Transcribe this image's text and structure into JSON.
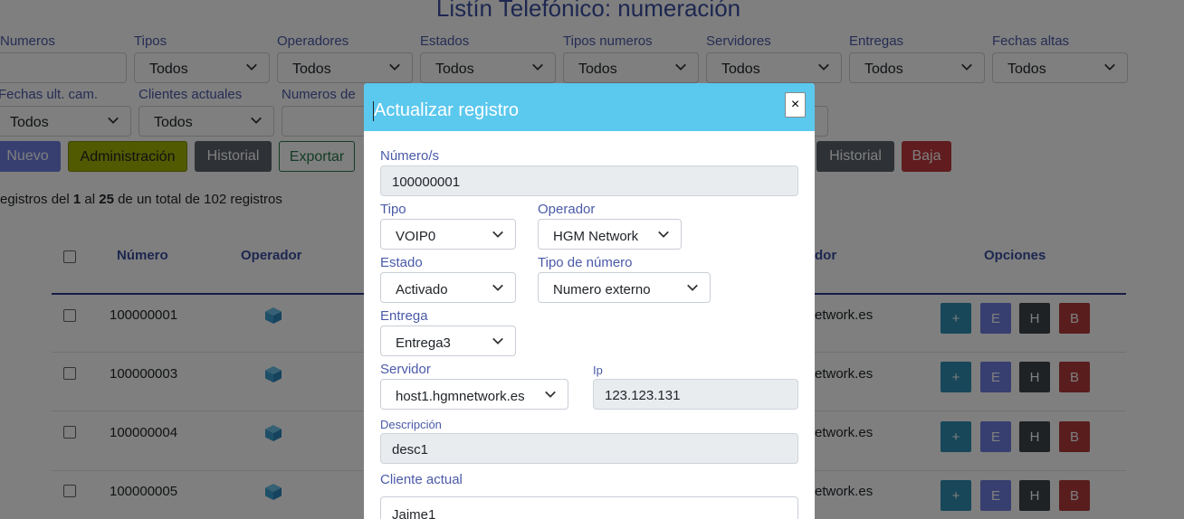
{
  "page_title": "Listín Telefónico: numeración",
  "filters": {
    "row1": [
      {
        "label": "Numeros",
        "type": "input",
        "value": ""
      },
      {
        "label": "Tipos",
        "type": "select",
        "value": "Todos"
      },
      {
        "label": "Operadores",
        "type": "select",
        "value": "Todos"
      },
      {
        "label": "Estados",
        "type": "select",
        "value": "Todos"
      },
      {
        "label": "Tipos numeros",
        "type": "select",
        "value": "Todos"
      },
      {
        "label": "Servidores",
        "type": "select",
        "value": "Todos"
      },
      {
        "label": "Entregas",
        "type": "select",
        "value": "Todos"
      },
      {
        "label": "Fechas altas",
        "type": "select",
        "value": "Todos"
      }
    ],
    "row2": [
      {
        "label": "Fechas ult. cam.",
        "type": "select",
        "value": "Todos"
      },
      {
        "label": "Clientes actuales",
        "type": "select",
        "value": "Todos"
      },
      {
        "label": "Numeros de",
        "type": "input",
        "value": ""
      }
    ]
  },
  "toolbar": {
    "nuevo": "Nuevo",
    "administracion": "Administración",
    "historial": "Historial",
    "exportar": "Exportar",
    "historial2": "Historial",
    "baja": "Baja"
  },
  "records_info": {
    "prefix": "egistros del ",
    "from": "1",
    "mid": " al ",
    "to": "25",
    "suffix": " de un total de 102 registros"
  },
  "table": {
    "headers": {
      "numero": "Número",
      "operador": "Operador",
      "servidor_partial": "dor",
      "opciones": "Opciones"
    },
    "rows": [
      {
        "numero": "100000001",
        "servidor": "etwork.es"
      },
      {
        "numero": "100000003",
        "servidor": "etwork.es"
      },
      {
        "numero": "100000004",
        "servidor": "etwork.es"
      },
      {
        "numero": "100000005",
        "servidor": "etwork.es"
      }
    ],
    "option_labels": {
      "add": "+",
      "edit": "E",
      "hist": "H",
      "baja": "B"
    }
  },
  "modal": {
    "title": "Actualizar registro",
    "close": "×",
    "numeros_label": "Número/s",
    "numeros_value": "100000001",
    "tipo_label": "Tipo",
    "tipo_value": "VOIP0",
    "operador_label": "Operador",
    "operador_value": "HGM Network",
    "estado_label": "Estado",
    "estado_value": "Activado",
    "tipo_numero_label": "Tipo de número",
    "tipo_numero_value": "Numero externo",
    "entrega_label": "Entrega",
    "entrega_value": "Entrega3",
    "servidor_label": "Servidor",
    "servidor_value": "host1.hgmnetwork.es",
    "ip_label": "Ip",
    "ip_value": "123.123.131",
    "descripcion_label": "Descripción",
    "descripcion_value": "desc1",
    "cliente_label": "Cliente actual",
    "cliente_value": "Jaime1"
  },
  "colors": {
    "accent": "#5bc8ee",
    "primary": "#6f7fe0",
    "header_text": "#3a4fa0",
    "danger": "#c0393d",
    "success": "#28784b"
  },
  "icons": {
    "select_arrow": "chevron-down-icon",
    "operator": "cube-icon"
  }
}
